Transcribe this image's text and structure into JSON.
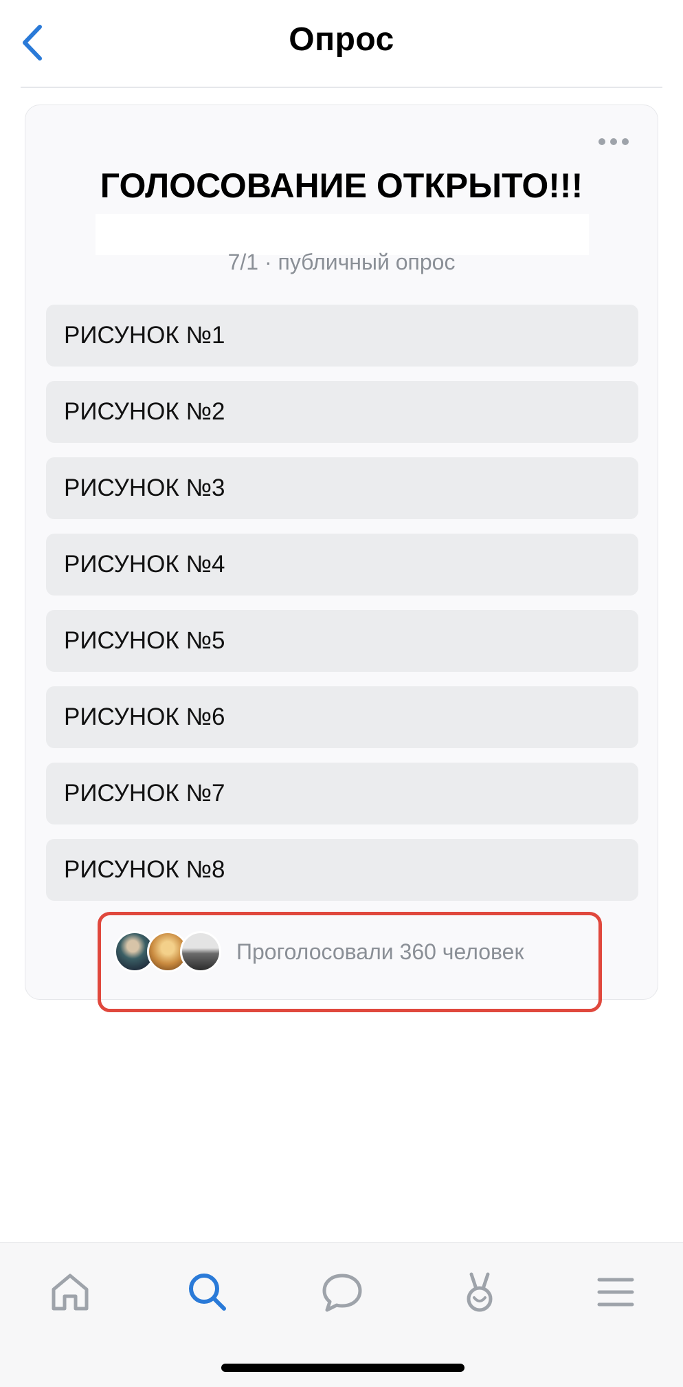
{
  "header": {
    "title": "Опрос"
  },
  "poll": {
    "title": "ГОЛОСОВАНИЕ ОТКРЫТО!!!",
    "meta": "7/1 · публичный опрос",
    "options": [
      {
        "label": "РИСУНОК №1"
      },
      {
        "label": "РИСУНОК №2"
      },
      {
        "label": "РИСУНОК №3"
      },
      {
        "label": "РИСУНОК №4"
      },
      {
        "label": "РИСУНОК №5"
      },
      {
        "label": "РИСУНОК №6"
      },
      {
        "label": "РИСУНОК №7"
      },
      {
        "label": "РИСУНОК №8"
      }
    ],
    "voters_text": "Проголосовали 360 человек"
  },
  "colors": {
    "accent": "#2a7ad8",
    "icon_gray": "#9ea3aa",
    "highlight": "#e0483d"
  },
  "tabbar": {
    "items": [
      {
        "name": "home-icon"
      },
      {
        "name": "search-icon"
      },
      {
        "name": "messages-icon"
      },
      {
        "name": "clips-icon"
      },
      {
        "name": "menu-icon"
      }
    ]
  }
}
